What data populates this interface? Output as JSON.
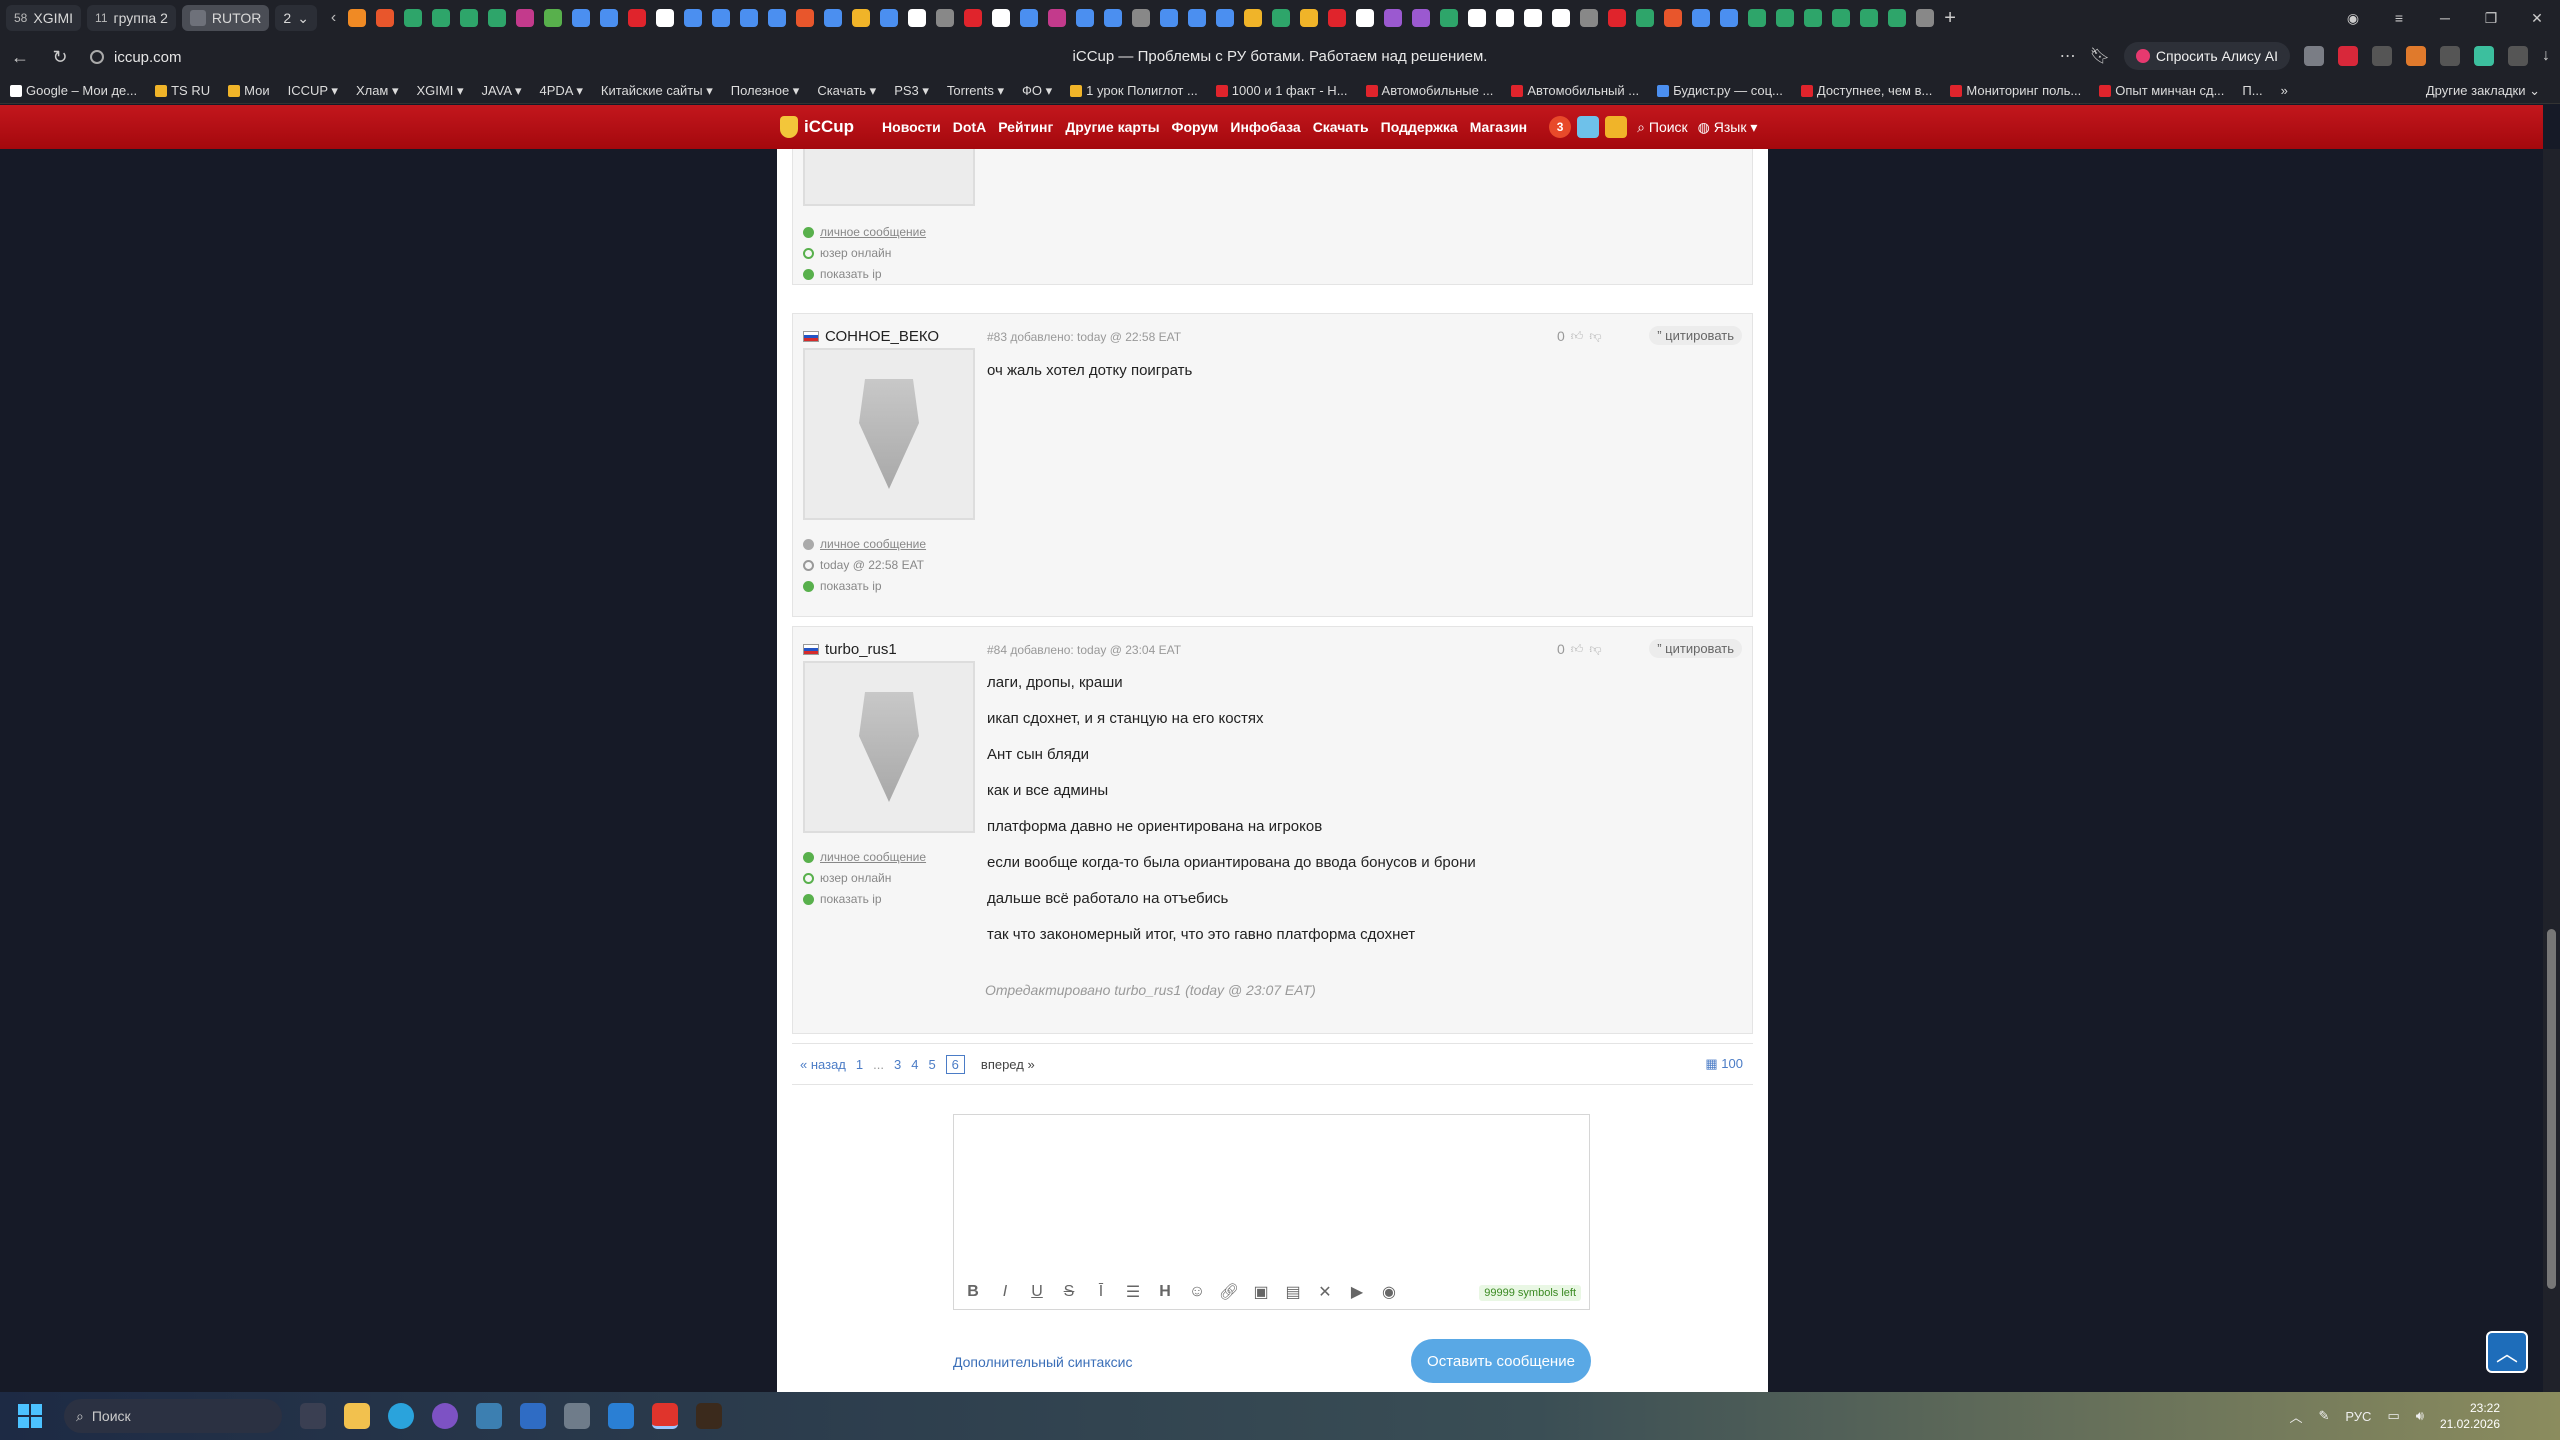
{
  "browser": {
    "tabs": [
      {
        "count": "58",
        "label": "XGIMI",
        "active": false
      },
      {
        "count": "11",
        "label": "группа 2",
        "active": false
      },
      {
        "count": "",
        "label": "RUTOR",
        "active": true
      },
      {
        "count": "",
        "label": "2",
        "active": false
      }
    ],
    "url": "iccup.com",
    "page_title": "iCCup — Проблемы с РУ ботами. Работаем над решением.",
    "alice_button": "Спросить Алису AI",
    "bookmarks": [
      "Google – Мои де...",
      "TS RU",
      "Мои",
      "ICCUP ▾",
      "Хлам ▾",
      "XGIMI ▾",
      "JAVA ▾",
      "4PDA ▾",
      "Китайские сайты ▾",
      "Полезное ▾",
      "Скачать ▾",
      "PS3 ▾",
      "Torrents ▾",
      "ФО ▾",
      "1 урок Полиглот ...",
      "1000 и 1 факт - Н...",
      "Автомобильные ...",
      "Автомобильный ...",
      "Будист.ру — соц...",
      "Доступнее, чем в...",
      "Мониторинг поль...",
      "Опыт минчан сд...",
      "П...",
      "»"
    ],
    "other_bookmarks": "Другие закладки"
  },
  "site": {
    "logo": "iCCup",
    "nav": [
      "Новости",
      "DotA",
      "Рейтинг",
      "Другие карты",
      "Форум",
      "Инфобаза",
      "Скачать",
      "Поддержка",
      "Магазин"
    ],
    "notif_count": "3",
    "search": "Поиск",
    "lang": "Язык ▾"
  },
  "prev_post_meta": {
    "pm": "личное сообщение",
    "status": "юзер онлайн",
    "ip": "показать ip"
  },
  "posts": [
    {
      "author": "СОННОЕ_ВЕКО",
      "info": "#83 добавлено: today @ 22:58 EAT",
      "votes": "0",
      "quote": "цитировать",
      "lines": [
        "оч жаль хотел дотку поиграть"
      ],
      "pm": "личное сообщение",
      "status": "today @ 22:58 EAT",
      "ip": "показать ip",
      "edited": ""
    },
    {
      "author": "turbo_rus1",
      "info": "#84 добавлено: today @ 23:04 EAT",
      "votes": "0",
      "quote": "цитировать",
      "lines": [
        "лаги, дропы, краши",
        "икап сдохнет, и я станцую на его костях",
        "Ант сын бляди",
        "как и все админы",
        "платформа давно не ориентирована на игроков",
        "если вообще когда-то была ориантирована до ввода бонусов и брони",
        "дальше всё работало на отъебись",
        "так что закономерный итог, что это гавно платформа сдохнет"
      ],
      "pm": "личное сообщение",
      "status": "юзер онлайн",
      "ip": "показать ip",
      "edited": "Отредактировано turbo_rus1 (today @ 23:07 EAT)"
    }
  ],
  "pager": {
    "prev": "« назад",
    "pages": [
      "1",
      "...",
      "3",
      "4",
      "5",
      "6"
    ],
    "current": "6",
    "next": "вперед »",
    "per_page": "100"
  },
  "editor": {
    "symbols_left": "99999 symbols left",
    "toolbar": [
      "bold-icon",
      "italic-icon",
      "underline-icon",
      "strikethrough-icon",
      "center-icon",
      "list-icon",
      "heading-icon",
      "smiley-icon",
      "link-icon",
      "image-icon",
      "gallery-icon",
      "formula-icon",
      "youtube-icon",
      "spoiler-icon"
    ]
  },
  "footer": {
    "extra_syntax": "Дополнительный синтаксис",
    "submit": "Оставить сообщение"
  },
  "taskbar": {
    "search": "Поиск",
    "lang": "РУС",
    "time": "23:22",
    "date": "21.02.2026"
  },
  "colors": {
    "header_red": "#b50f15",
    "accent_blue": "#59a8e5",
    "link_blue": "#4b7cc6"
  }
}
